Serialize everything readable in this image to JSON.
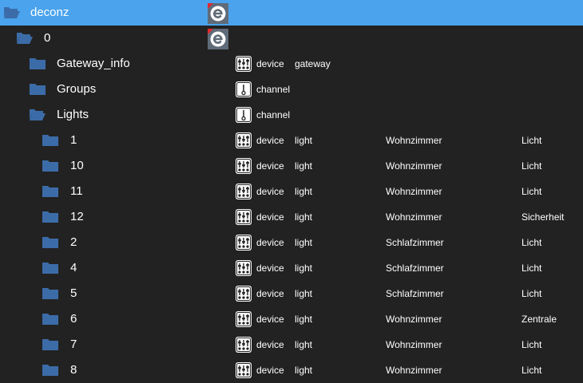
{
  "colors": {
    "background": "#222222",
    "selected_row": "#4aa3ec",
    "folder": "#3c6ca8",
    "text": "#ffffff",
    "logo_bg": "#5f6b78",
    "logo_accent": "#e4262d"
  },
  "tree": [
    {
      "name": "deconz",
      "level": 0,
      "folder_state": "open",
      "selected": true,
      "show_logo": true,
      "type_icon": "",
      "type": "",
      "role": "",
      "room": "",
      "function": ""
    },
    {
      "name": "0",
      "level": 1,
      "folder_state": "open",
      "selected": false,
      "show_logo": true,
      "type_icon": "",
      "type": "",
      "role": "",
      "room": "",
      "function": ""
    },
    {
      "name": "Gateway_info",
      "level": 2,
      "folder_state": "closed",
      "selected": false,
      "show_logo": false,
      "type_icon": "device-icon",
      "type": "device",
      "role": "gateway",
      "room": "",
      "function": ""
    },
    {
      "name": "Groups",
      "level": 2,
      "folder_state": "closed",
      "selected": false,
      "show_logo": false,
      "type_icon": "channel-icon",
      "type": "channel",
      "role": "",
      "room": "",
      "function": ""
    },
    {
      "name": "Lights",
      "level": 2,
      "folder_state": "open",
      "selected": false,
      "show_logo": false,
      "type_icon": "channel-icon",
      "type": "channel",
      "role": "",
      "room": "",
      "function": ""
    },
    {
      "name": "1",
      "level": 3,
      "folder_state": "closed",
      "selected": false,
      "show_logo": false,
      "type_icon": "device-icon",
      "type": "device",
      "role": "light",
      "room": "Wohnzimmer",
      "function": "Licht"
    },
    {
      "name": "10",
      "level": 3,
      "folder_state": "closed",
      "selected": false,
      "show_logo": false,
      "type_icon": "device-icon",
      "type": "device",
      "role": "light",
      "room": "Wohnzimmer",
      "function": "Licht"
    },
    {
      "name": "11",
      "level": 3,
      "folder_state": "closed",
      "selected": false,
      "show_logo": false,
      "type_icon": "device-icon",
      "type": "device",
      "role": "light",
      "room": "Wohnzimmer",
      "function": "Licht"
    },
    {
      "name": "12",
      "level": 3,
      "folder_state": "closed",
      "selected": false,
      "show_logo": false,
      "type_icon": "device-icon",
      "type": "device",
      "role": "light",
      "room": "Wohnzimmer",
      "function": "Sicherheit"
    },
    {
      "name": "2",
      "level": 3,
      "folder_state": "closed",
      "selected": false,
      "show_logo": false,
      "type_icon": "device-icon",
      "type": "device",
      "role": "light",
      "room": "Schlafzimmer",
      "function": "Licht"
    },
    {
      "name": "4",
      "level": 3,
      "folder_state": "closed",
      "selected": false,
      "show_logo": false,
      "type_icon": "device-icon",
      "type": "device",
      "role": "light",
      "room": "Schlafzimmer",
      "function": "Licht"
    },
    {
      "name": "5",
      "level": 3,
      "folder_state": "closed",
      "selected": false,
      "show_logo": false,
      "type_icon": "device-icon",
      "type": "device",
      "role": "light",
      "room": "Schlafzimmer",
      "function": "Licht"
    },
    {
      "name": "6",
      "level": 3,
      "folder_state": "closed",
      "selected": false,
      "show_logo": false,
      "type_icon": "device-icon",
      "type": "device",
      "role": "light",
      "room": "Wohnzimmer",
      "function": "Zentrale"
    },
    {
      "name": "7",
      "level": 3,
      "folder_state": "closed",
      "selected": false,
      "show_logo": false,
      "type_icon": "device-icon",
      "type": "device",
      "role": "light",
      "room": "Wohnzimmer",
      "function": "Licht"
    },
    {
      "name": "8",
      "level": 3,
      "folder_state": "closed",
      "selected": false,
      "show_logo": false,
      "type_icon": "device-icon",
      "type": "device",
      "role": "light",
      "room": "Wohnzimmer",
      "function": "Licht"
    }
  ]
}
